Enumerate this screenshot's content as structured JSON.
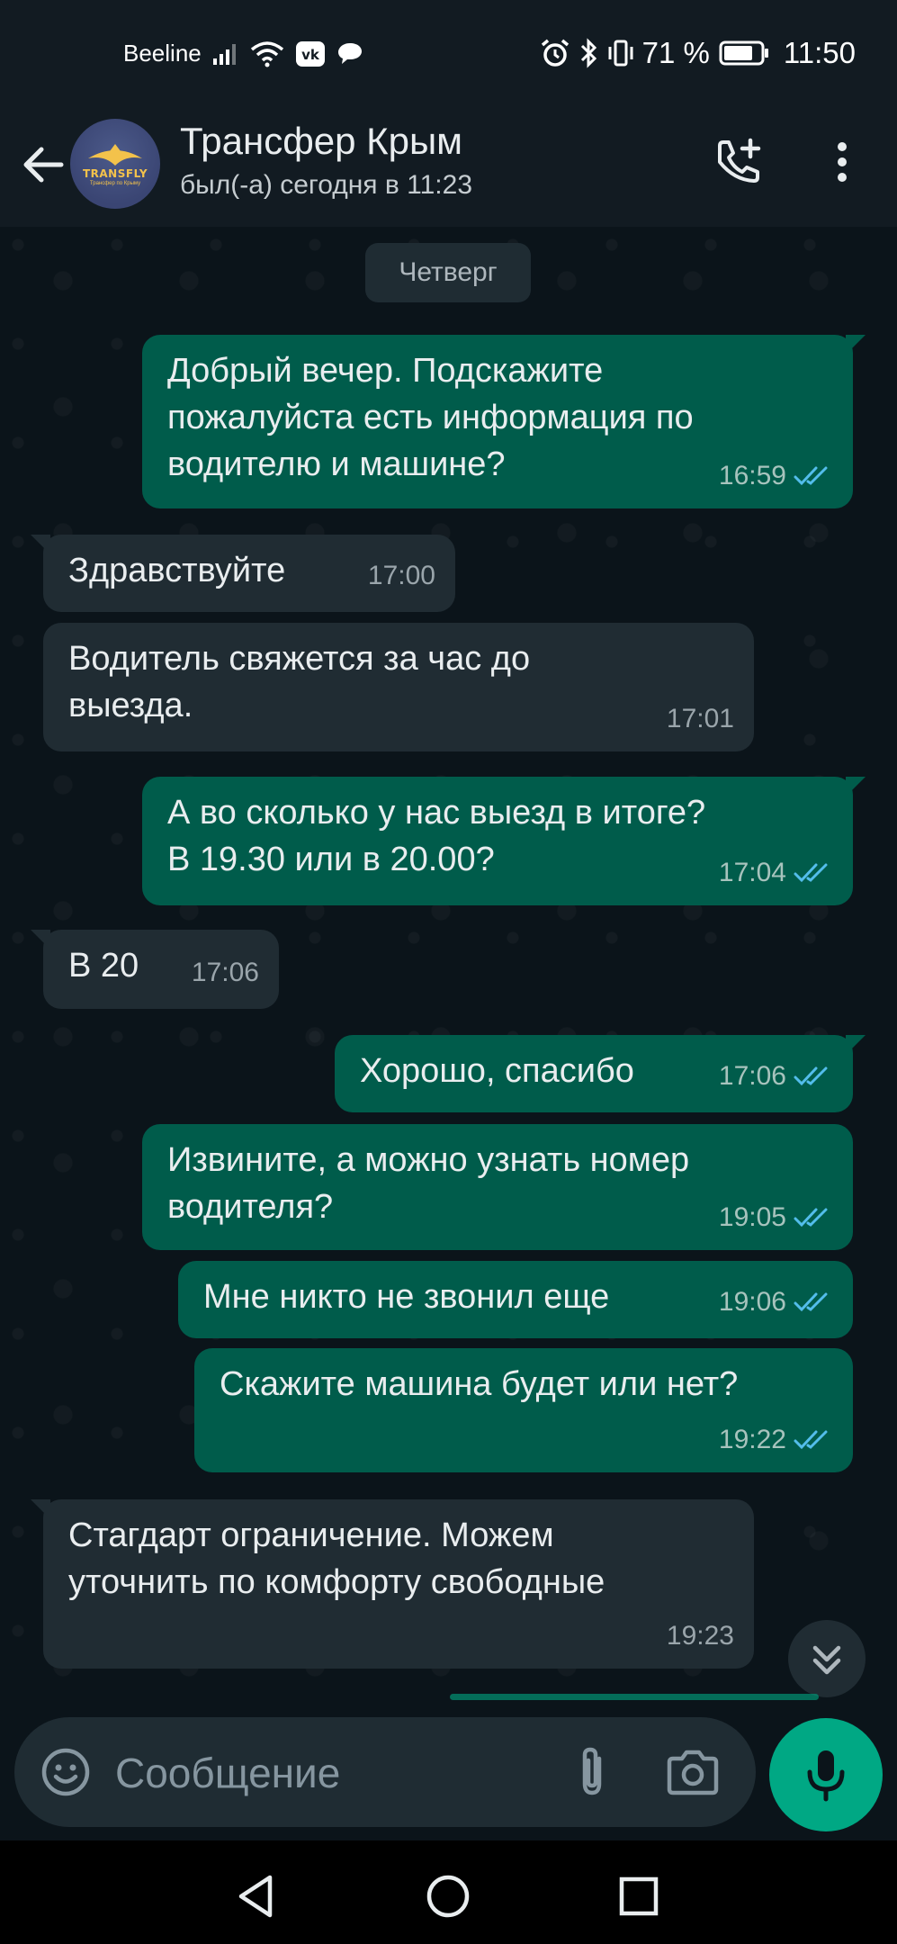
{
  "status_bar": {
    "carrier": "Beeline",
    "battery_percent": "71 %",
    "time": "11:50",
    "icons": [
      "signal-icon",
      "wifi-icon",
      "vk-icon",
      "chat-notification-icon",
      "alarm-icon",
      "bluetooth-icon",
      "vibrate-icon",
      "battery-icon"
    ]
  },
  "header": {
    "title": "Трансфер Крым",
    "subtitle": "был(-а) сегодня в 11:23",
    "avatar_text": "TRANSFLY",
    "avatar_subtext": "Трансфер по Крыму"
  },
  "chat": {
    "date_label": "Четверг",
    "messages": [
      {
        "dir": "out",
        "text": "Добрый вечер. Подскажите\nпожалуйста есть информация по\nводителю и машине?",
        "time": "16:59",
        "read": true
      },
      {
        "dir": "in",
        "text": "Здравствуйте",
        "time": "17:00"
      },
      {
        "dir": "in",
        "text": "Водитель свяжется за час до\nвыезда.",
        "time": "17:01"
      },
      {
        "dir": "out",
        "text": "А во сколько у нас выезд в итоге?\nВ 19.30 или в 20.00?",
        "time": "17:04",
        "read": true
      },
      {
        "dir": "in",
        "text": "В 20",
        "time": "17:06"
      },
      {
        "dir": "out",
        "text": "Хорошо, спасибо",
        "time": "17:06",
        "read": true
      },
      {
        "dir": "out",
        "text": "Извините, а можно узнать номер\nводителя?",
        "time": "19:05",
        "read": true
      },
      {
        "dir": "out",
        "text": "Мне никто не звонил еще",
        "time": "19:06",
        "read": true
      },
      {
        "dir": "out",
        "text": "Скажите машина будет или нет?",
        "time": "19:22",
        "read": true
      },
      {
        "dir": "in",
        "text": "Стагдарт ограничение. Можем\nуточнить по комфорту свободные",
        "time": "19:23"
      }
    ]
  },
  "input": {
    "placeholder": "Сообщение"
  },
  "colors": {
    "background": "#0b141a",
    "outgoing_bubble": "#005c4b",
    "incoming_bubble": "#202c33",
    "accent": "#00a884",
    "read_ticks": "#53bdeb"
  }
}
